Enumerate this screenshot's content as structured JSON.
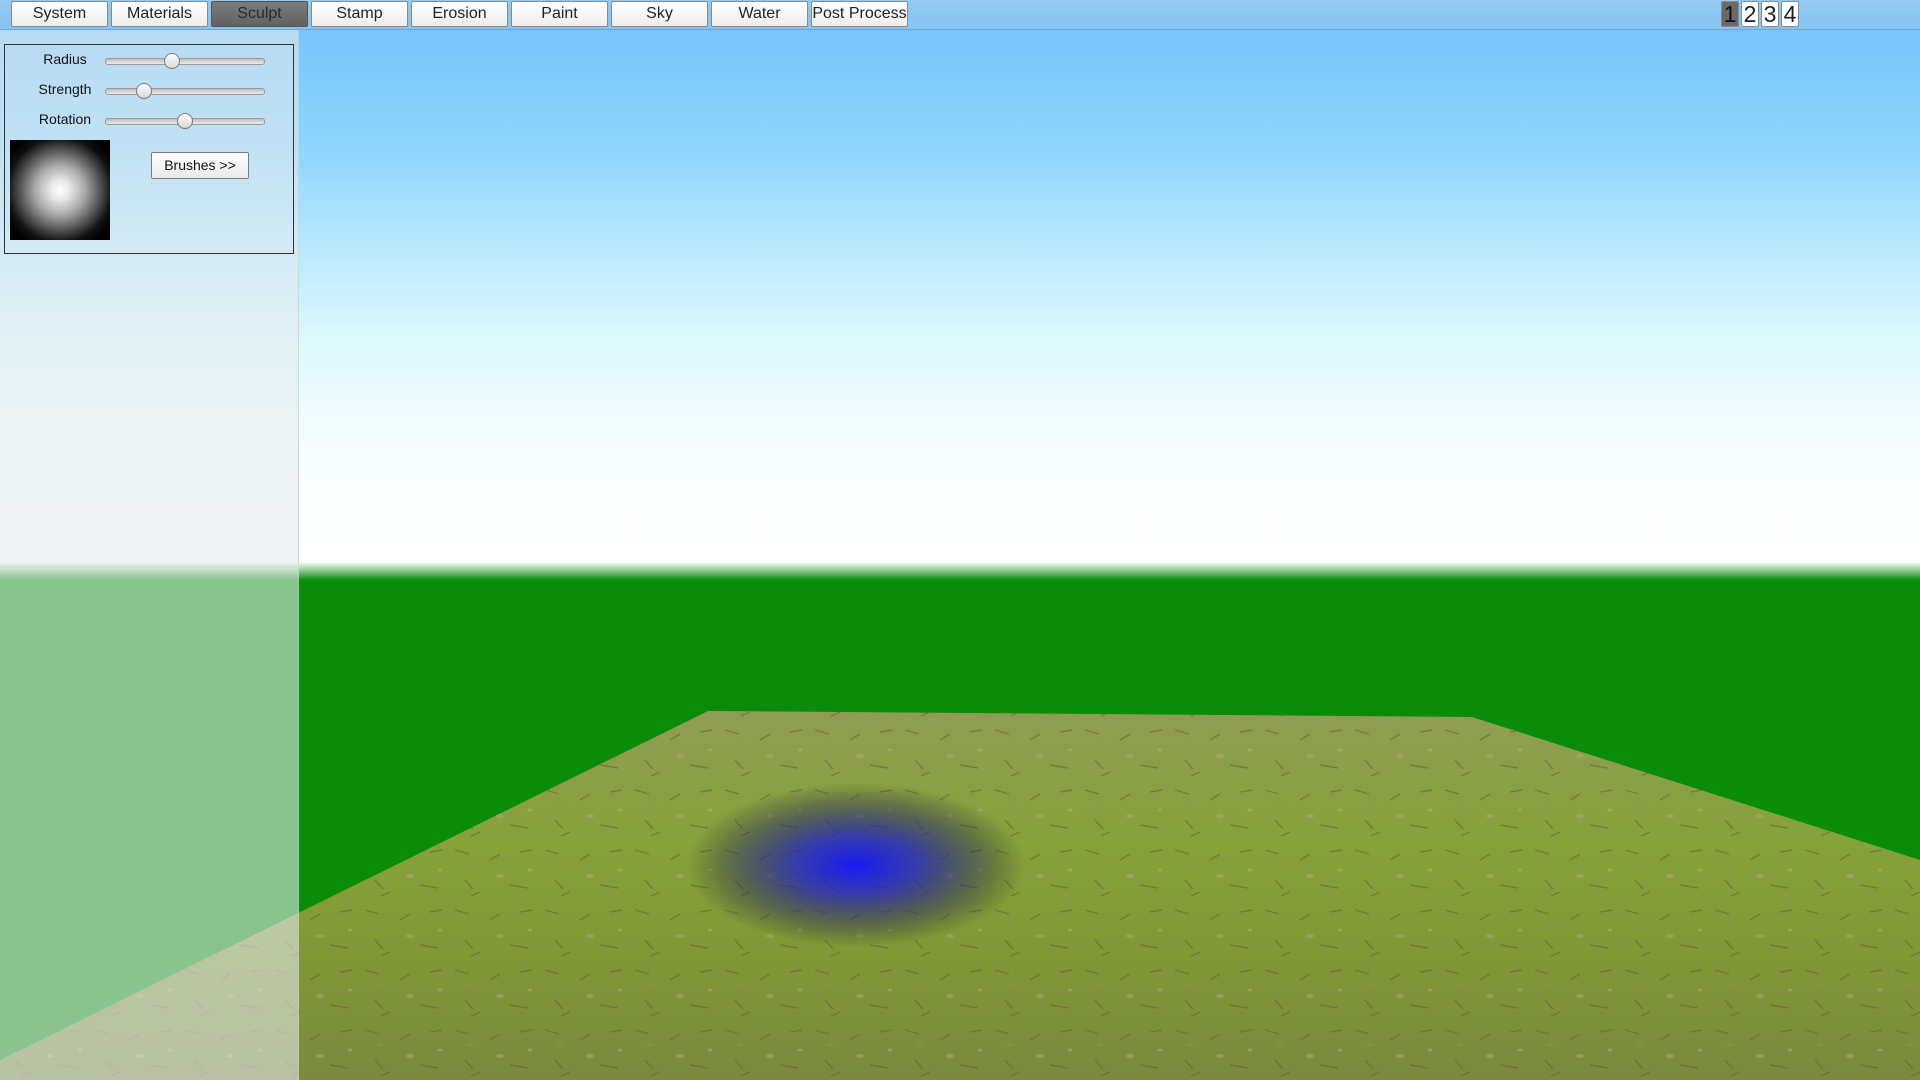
{
  "toolbar": {
    "tabs": [
      {
        "label": "System",
        "active": false
      },
      {
        "label": "Materials",
        "active": false
      },
      {
        "label": "Sculpt",
        "active": true
      },
      {
        "label": "Stamp",
        "active": false
      },
      {
        "label": "Erosion",
        "active": false
      },
      {
        "label": "Paint",
        "active": false
      },
      {
        "label": "Sky",
        "active": false
      },
      {
        "label": "Water",
        "active": false
      },
      {
        "label": "Post Process",
        "active": false
      }
    ],
    "views": [
      {
        "label": "1",
        "active": true
      },
      {
        "label": "2",
        "active": false
      },
      {
        "label": "3",
        "active": false
      },
      {
        "label": "4",
        "active": false
      }
    ]
  },
  "sculpt_panel": {
    "radius": {
      "label": "Radius",
      "value_fraction": 0.42
    },
    "strength": {
      "label": "Strength",
      "value_fraction": 0.24
    },
    "rotation": {
      "label": "Rotation",
      "value_fraction": 0.5
    },
    "brushes_button": "Brushes >>"
  },
  "colors": {
    "sky_top": "#72c1fb",
    "horizon": "#ffffff",
    "ground_plane": "#0a8c0a",
    "terrain_grass": "#7e9a37",
    "brush_cursor": "#1a1ad8",
    "active_tab": "#6e6e6e"
  }
}
